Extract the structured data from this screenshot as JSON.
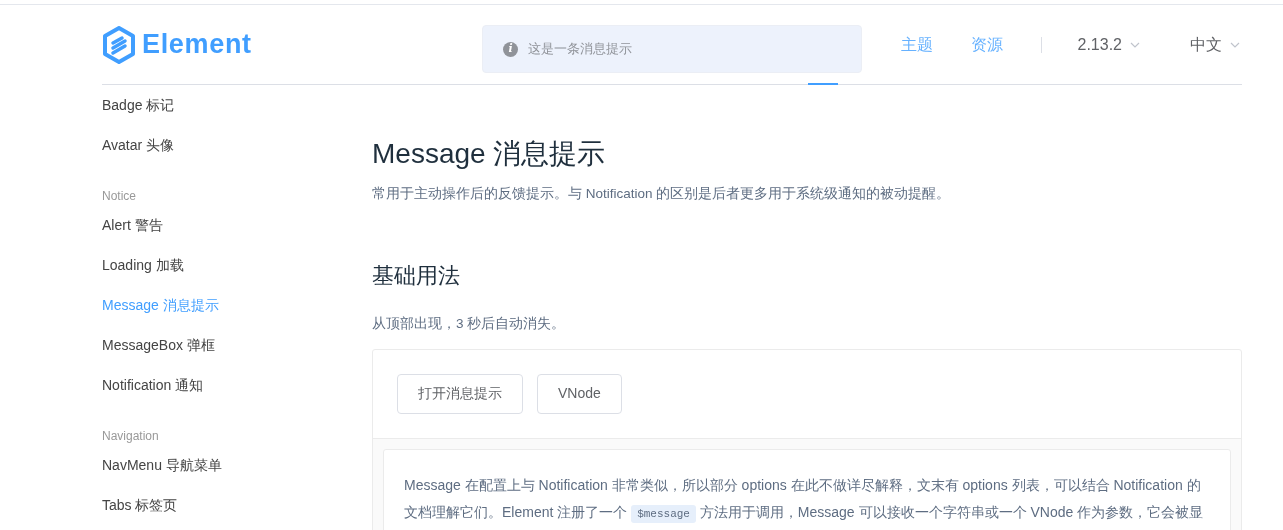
{
  "header": {
    "logo": "Element",
    "message": {
      "icon": "i",
      "text": "这是一条消息提示"
    },
    "nav": [
      {
        "label": "主题",
        "kind": "link"
      },
      {
        "label": "资源",
        "kind": "link"
      },
      {
        "label": "2.13.2",
        "kind": "dropdown"
      },
      {
        "label": "中文",
        "kind": "dropdown"
      }
    ]
  },
  "sidebar": {
    "items": [
      {
        "label": "Badge 标记",
        "kind": "item",
        "selected": false
      },
      {
        "label": "Avatar 头像",
        "kind": "item",
        "selected": false
      },
      {
        "label": "Notice",
        "kind": "group"
      },
      {
        "label": "Alert 警告",
        "kind": "item",
        "selected": false
      },
      {
        "label": "Loading 加载",
        "kind": "item",
        "selected": false
      },
      {
        "label": "Message 消息提示",
        "kind": "item",
        "selected": true
      },
      {
        "label": "MessageBox 弹框",
        "kind": "item",
        "selected": false
      },
      {
        "label": "Notification 通知",
        "kind": "item",
        "selected": false
      },
      {
        "label": "Navigation",
        "kind": "group"
      },
      {
        "label": "NavMenu 导航菜单",
        "kind": "item",
        "selected": false
      },
      {
        "label": "Tabs 标签页",
        "kind": "item",
        "selected": false
      }
    ]
  },
  "content": {
    "title": "Message 消息提示",
    "description": "常用于主动操作后的反馈提示。与 Notification 的区别是后者更多用于系统级通知的被动提醒。",
    "section_title": "基础用法",
    "section_description": "从顶部出现，3 秒后自动消失。",
    "demo_buttons": [
      "打开消息提示",
      "VNode"
    ],
    "note": {
      "before": "Message 在配置上与 Notification 非常类似，所以部分 options 在此不做详尽解释，文末有 options 列表，可以结合 Notification 的文档理解它们。Element 注册了一个",
      "code": "$message",
      "after": "方法用于调用，Message 可以接收一个字符串或一个 VNode 作为参数，它会被显"
    }
  }
}
